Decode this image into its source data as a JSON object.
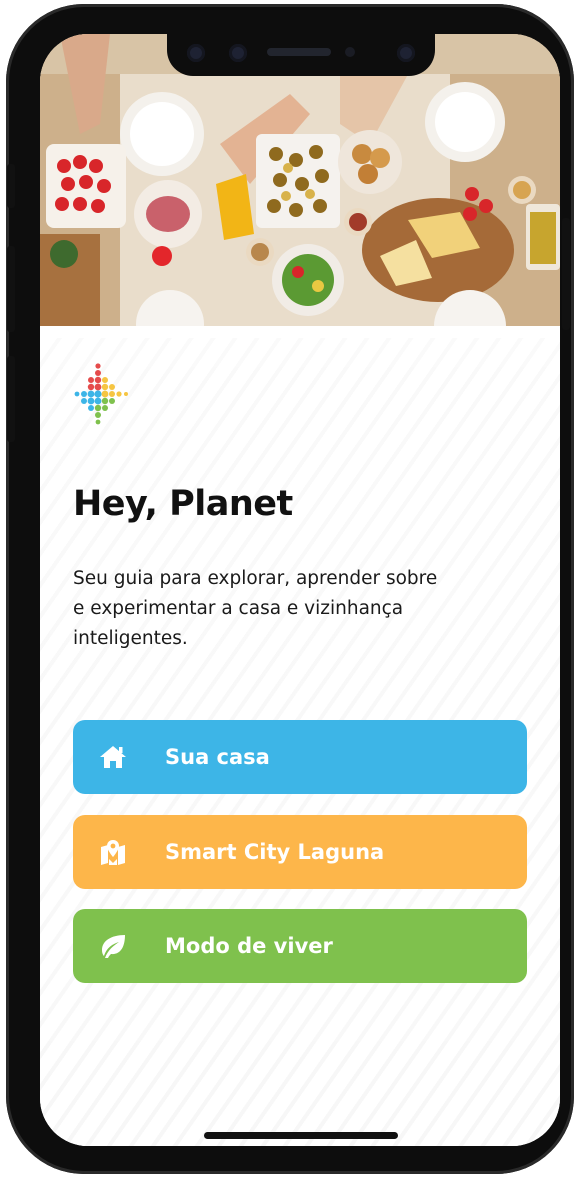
{
  "app": {
    "title": "Hey, Planet",
    "subtitle": "Seu guia para explorar, aprender sobre e experimentar a casa e vizinhança inteligentes.",
    "hero_image": "food-table-photo",
    "logo_icon": "colorful-dots-logo-icon"
  },
  "menu": {
    "items": [
      {
        "label": "Sua casa",
        "icon": "home-icon",
        "color": "#3db5e7"
      },
      {
        "label": "Smart City Laguna",
        "icon": "map-pin-icon",
        "color": "#fdb64a"
      },
      {
        "label": "Modo de viver",
        "icon": "leaf-icon",
        "color": "#7fc14d"
      }
    ]
  },
  "colors": {
    "logo_red": "#e54b4b",
    "logo_yellow": "#f6c542",
    "logo_blue": "#3db5e7",
    "logo_green": "#7fc14d"
  }
}
